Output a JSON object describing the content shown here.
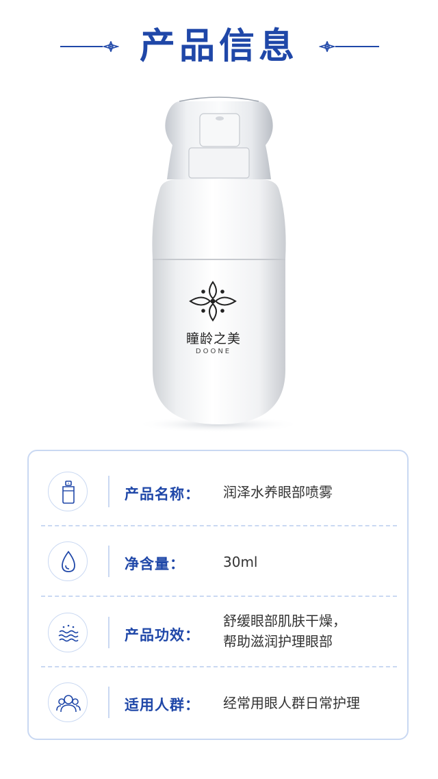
{
  "header": {
    "title": "产品信息"
  },
  "product": {
    "brand_cn": "瞳龄之美",
    "brand_en": "DOONE"
  },
  "info": [
    {
      "label": "产品名称：",
      "value_lines": [
        "润泽水养眼部喷雾"
      ],
      "icon": "spray-bottle-icon"
    },
    {
      "label": "净含量：",
      "value_lines": [
        "30ml"
      ],
      "icon": "water-drop-icon"
    },
    {
      "label": "产品功效：",
      "value_lines": [
        "舒缓眼部肌肤干燥，",
        "帮助滋润护理眼部"
      ],
      "icon": "waves-icon"
    },
    {
      "label": "适用人群：",
      "value_lines": [
        "经常用眼人群日常护理"
      ],
      "icon": "people-icon"
    }
  ],
  "colors": {
    "accent": "#1f47a8",
    "border": "#c9d8f2",
    "text": "#333333"
  }
}
